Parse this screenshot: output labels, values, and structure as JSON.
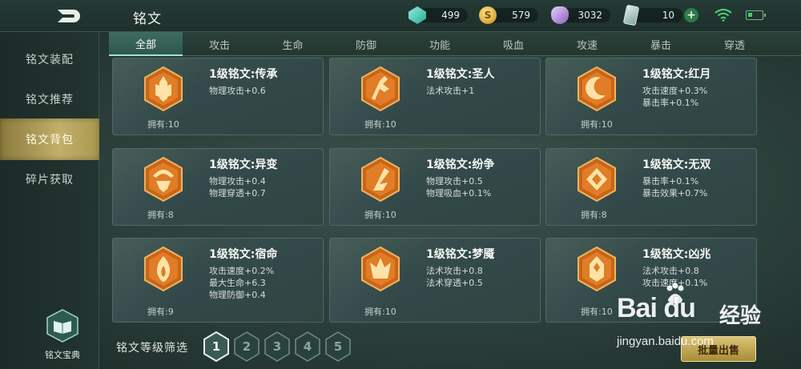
{
  "header": {
    "title": "铭文",
    "currencies": [
      {
        "icon": "gem-icon",
        "value": "499"
      },
      {
        "icon": "gold-coin-icon",
        "value": "579"
      },
      {
        "icon": "crystal-icon",
        "value": "3032"
      },
      {
        "icon": "card-icon",
        "value": "10"
      }
    ]
  },
  "sidebar": {
    "items": [
      {
        "label": "铭文装配"
      },
      {
        "label": "铭文推荐"
      },
      {
        "label": "铭文背包"
      },
      {
        "label": "碎片获取"
      }
    ],
    "active_index": 2,
    "codex_label": "铭文宝典"
  },
  "tabs": {
    "items": [
      "全部",
      "攻击",
      "生命",
      "防御",
      "功能",
      "吸血",
      "攻速",
      "暴击",
      "穿透"
    ],
    "active_index": 0
  },
  "runes": [
    {
      "name": "1级铭文:传承",
      "stats": [
        "物理攻击+0.6"
      ],
      "owned": "拥有:10",
      "icon": "rune-inheritance-icon"
    },
    {
      "name": "1级铭文:圣人",
      "stats": [
        "法术攻击+1"
      ],
      "owned": "拥有:10",
      "icon": "rune-sage-icon"
    },
    {
      "name": "1级铭文:红月",
      "stats": [
        "攻击速度+0.3%",
        "暴击率+0.1%"
      ],
      "owned": "拥有:10",
      "icon": "rune-red-moon-icon"
    },
    {
      "name": "1级铭文:异变",
      "stats": [
        "物理攻击+0.4",
        "物理穿透+0.7"
      ],
      "owned": "拥有:8",
      "icon": "rune-mutation-icon"
    },
    {
      "name": "1级铭文:纷争",
      "stats": [
        "物理攻击+0.5",
        "物理吸血+0.1%"
      ],
      "owned": "拥有:10",
      "icon": "rune-strife-icon"
    },
    {
      "name": "1级铭文:无双",
      "stats": [
        "暴击率+0.1%",
        "暴击效果+0.7%"
      ],
      "owned": "拥有:8",
      "icon": "rune-peerless-icon"
    },
    {
      "name": "1级铭文:宿命",
      "stats": [
        "攻击速度+0.2%",
        "最大生命+6.3",
        "物理防御+0.4"
      ],
      "owned": "拥有:9",
      "icon": "rune-fate-icon"
    },
    {
      "name": "1级铭文:梦魇",
      "stats": [
        "法术攻击+0.8",
        "法术穿透+0.5"
      ],
      "owned": "拥有:10",
      "icon": "rune-nightmare-icon"
    },
    {
      "name": "1级铭文:凶兆",
      "stats": [
        "法术攻击+0.8",
        "攻击速度+0.1%"
      ],
      "owned": "拥有:10",
      "icon": "rune-omen-icon"
    }
  ],
  "filter": {
    "label": "铭文等级筛选",
    "levels": [
      "1",
      "2",
      "3",
      "4",
      "5"
    ],
    "active_index": 0
  },
  "bulk_sell_label": "批量出售",
  "watermark": {
    "brand": "Bai du",
    "brand_cn": "经验",
    "url": "jingyan.baidu.com"
  },
  "colors": {
    "accent_gold": "#c2b06a",
    "rune_orange": "#d9701c",
    "tab_active": "#3d6c60"
  }
}
